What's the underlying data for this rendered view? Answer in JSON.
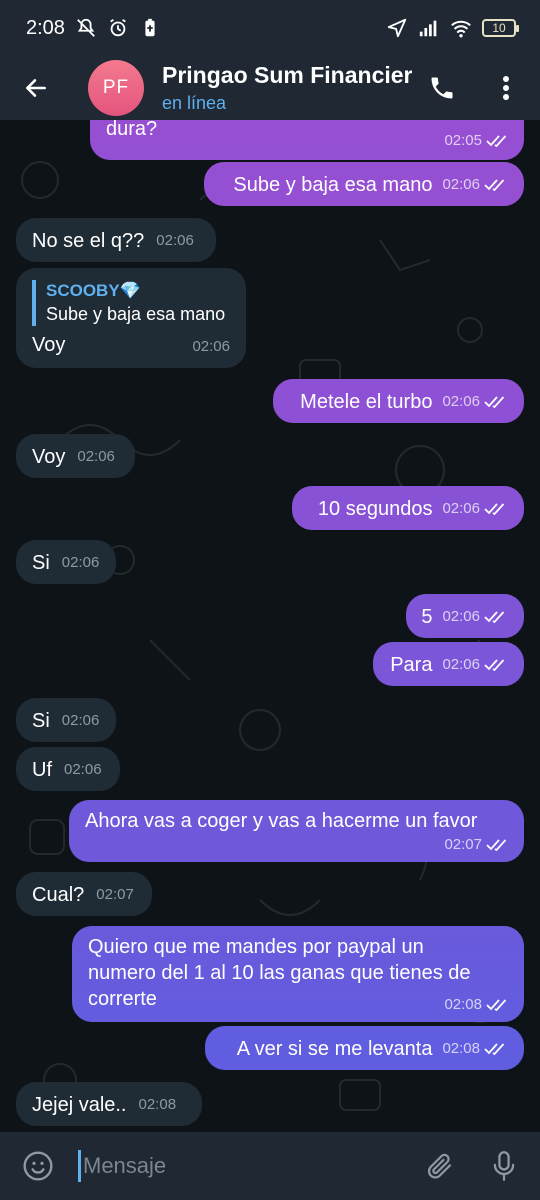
{
  "status_bar": {
    "time": "2:08",
    "battery": "10"
  },
  "header": {
    "avatar_initials": "PF",
    "title": "Pringao Sum Financier",
    "status": "en línea"
  },
  "messages": [
    {
      "dir": "out",
      "text": "Qué puedes hacer para que se me ponga\ndura?",
      "time": "02:05"
    },
    {
      "dir": "out",
      "text": "Sube y baja esa mano",
      "time": "02:06"
    },
    {
      "dir": "in",
      "text": "No se el q??",
      "time": "02:06"
    },
    {
      "dir": "in",
      "reply_name": "SCOOBY💎",
      "reply_text": "Sube y baja esa mano",
      "text": "Voy",
      "time": "02:06"
    },
    {
      "dir": "out",
      "text": "Metele el turbo",
      "time": "02:06"
    },
    {
      "dir": "in",
      "text": "Voy",
      "time": "02:06"
    },
    {
      "dir": "out",
      "text": "10 segundos",
      "time": "02:06"
    },
    {
      "dir": "in",
      "text": "Si",
      "time": "02:06"
    },
    {
      "dir": "out",
      "text": "5",
      "time": "02:06"
    },
    {
      "dir": "out",
      "text": "Para",
      "time": "02:06"
    },
    {
      "dir": "in",
      "text": "Si",
      "time": "02:06"
    },
    {
      "dir": "in",
      "text": "Uf",
      "time": "02:06"
    },
    {
      "dir": "out",
      "text": "Ahora vas a coger y vas a hacerme un favor",
      "time": "02:07"
    },
    {
      "dir": "in",
      "text": "Cual?",
      "time": "02:07"
    },
    {
      "dir": "out",
      "text": "Quiero que me mandes por paypal un\nnumero del 1 al 10 las ganas que tienes de\ncorrerte",
      "time": "02:08"
    },
    {
      "dir": "out",
      "text": "A ver si se me levanta",
      "time": "02:08"
    },
    {
      "dir": "in",
      "text": "Jejej vale..",
      "time": "02:08"
    }
  ],
  "input": {
    "placeholder": "Mensaje"
  },
  "colors": {
    "bar_bg": "#1f2833",
    "incoming_bubble": "#1f2b35",
    "outgoing_gradient_top": "#9a4fd0",
    "outgoing_gradient_bottom": "#5b5fe6",
    "accent": "#5eb0ef"
  }
}
